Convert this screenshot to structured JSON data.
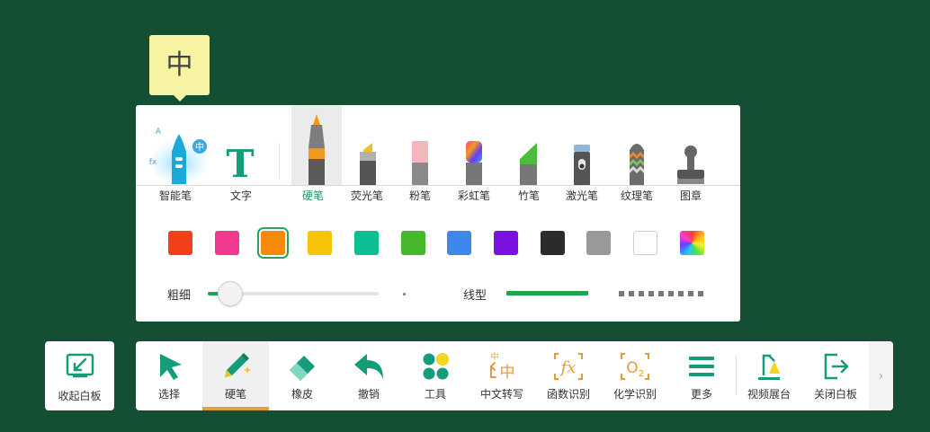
{
  "hint_bubble": {
    "char": "中"
  },
  "pen_panel": {
    "tools": [
      {
        "key": "smart",
        "label": "智能笔",
        "icon": "smart-pen-icon",
        "active": false
      },
      {
        "key": "text",
        "label": "文字",
        "icon": "text-tool-icon",
        "active": false
      },
      {
        "key": "hard",
        "label": "硬笔",
        "icon": "hard-pen-icon",
        "active": true
      },
      {
        "key": "highlighter",
        "label": "荧光笔",
        "icon": "highlighter-icon",
        "active": false
      },
      {
        "key": "chalk",
        "label": "粉笔",
        "icon": "chalk-icon",
        "active": false
      },
      {
        "key": "rainbow",
        "label": "彩虹笔",
        "icon": "rainbow-pen-icon",
        "active": false
      },
      {
        "key": "bamboo",
        "label": "竹笔",
        "icon": "bamboo-pen-icon",
        "active": false
      },
      {
        "key": "laser",
        "label": "激光笔",
        "icon": "laser-pen-icon",
        "active": false
      },
      {
        "key": "texture",
        "label": "纹理笔",
        "icon": "texture-pen-icon",
        "active": false
      },
      {
        "key": "stamp",
        "label": "图章",
        "icon": "stamp-icon",
        "active": false
      }
    ],
    "text_glyph": "T",
    "smart_badge": "中",
    "smart_a": "A",
    "smart_fx": "fx",
    "colors": [
      "#f2401b",
      "#f3388f",
      "#f5890a",
      "#f7c409",
      "#0fbd94",
      "#44b82a",
      "#3f86ee",
      "#7b10e0",
      "#2b2b2b",
      "#999999",
      "#ffffff",
      "rainbow"
    ],
    "selected_color_index": 2,
    "thickness_label": "粗细",
    "thickness_level": 0.13,
    "linetype_label": "线型"
  },
  "collapse": {
    "label": "收起白板",
    "icon": "collapse-icon"
  },
  "toolbar": {
    "items": [
      {
        "key": "select",
        "label": "选择",
        "icon": "select-cursor-icon"
      },
      {
        "key": "hardpen",
        "label": "硬笔",
        "icon": "pen-icon"
      },
      {
        "key": "eraser",
        "label": "橡皮",
        "icon": "eraser-icon"
      },
      {
        "key": "undo",
        "label": "撤销",
        "icon": "undo-icon"
      },
      {
        "key": "tools",
        "label": "工具",
        "icon": "tools-icon"
      },
      {
        "key": "chinese",
        "label": "中文转写",
        "icon": "chinese-transcribe-icon"
      },
      {
        "key": "function",
        "label": "函数识别",
        "icon": "function-recognize-icon"
      },
      {
        "key": "chemistry",
        "label": "化学识别",
        "icon": "chemistry-recognize-icon"
      },
      {
        "key": "more",
        "label": "更多",
        "icon": "menu-icon"
      },
      {
        "key": "video",
        "label": "视频展台",
        "icon": "video-booth-icon"
      },
      {
        "key": "close",
        "label": "关闭白板",
        "icon": "exit-icon"
      }
    ],
    "active_index": 1,
    "chinese_glyph": "中",
    "chinese_small": "中",
    "fx_glyph": "fx",
    "o2_glyph": "O",
    "o2_sub": "2",
    "scroll_glyph": "›"
  },
  "colors": {
    "brand_green": "#1fa34f",
    "accent_orange": "#e3a043",
    "teal": "#159c7b"
  }
}
